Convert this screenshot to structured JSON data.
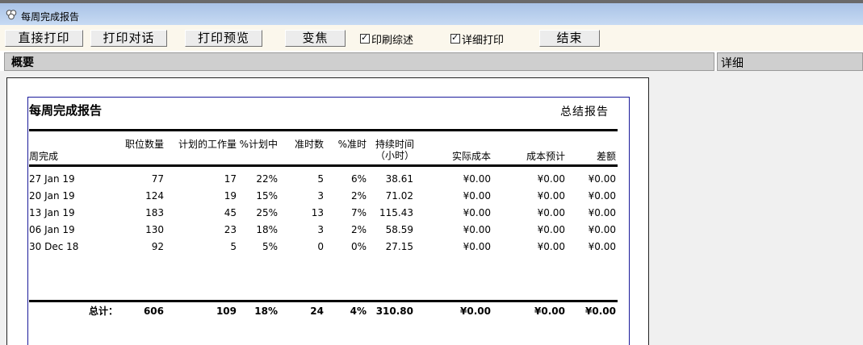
{
  "window": {
    "title": "每周完成报告"
  },
  "toolbar": {
    "direct_print": "直接打印",
    "print_dialog": "打印对话",
    "print_preview": "打印预览",
    "zoom": "变焦",
    "print_summary": "印刷综述",
    "print_detail": "详细打印",
    "finish": "结束"
  },
  "sections": {
    "overview": "概要",
    "detail": "详细"
  },
  "report": {
    "title": "每周完成报告",
    "right_title": "总结报告",
    "headers": {
      "week": "周完成",
      "positions": "职位数量",
      "planned_work": "计划的工作量",
      "pct_planned": "%计划中",
      "on_time_count": "准时数",
      "pct_on_time": "%准时",
      "duration": "持续时间",
      "duration_unit": "（小时）",
      "actual_cost": "实际成本",
      "cost_estimate": "成本预计",
      "variance": "差额"
    },
    "rows": [
      {
        "week": "27 Jan 19",
        "positions": "77",
        "planned": "17",
        "pct_planned": "22%",
        "on_time": "5",
        "pct_on_time": "6%",
        "duration": "38.61",
        "actual": "¥0.00",
        "estimate": "¥0.00",
        "variance": "¥0.00"
      },
      {
        "week": "20 Jan 19",
        "positions": "124",
        "planned": "19",
        "pct_planned": "15%",
        "on_time": "3",
        "pct_on_time": "2%",
        "duration": "71.02",
        "actual": "¥0.00",
        "estimate": "¥0.00",
        "variance": "¥0.00"
      },
      {
        "week": "13 Jan 19",
        "positions": "183",
        "planned": "45",
        "pct_planned": "25%",
        "on_time": "13",
        "pct_on_time": "7%",
        "duration": "115.43",
        "actual": "¥0.00",
        "estimate": "¥0.00",
        "variance": "¥0.00"
      },
      {
        "week": "06 Jan 19",
        "positions": "130",
        "planned": "23",
        "pct_planned": "18%",
        "on_time": "3",
        "pct_on_time": "2%",
        "duration": "58.59",
        "actual": "¥0.00",
        "estimate": "¥0.00",
        "variance": "¥0.00"
      },
      {
        "week": "30 Dec 18",
        "positions": "92",
        "planned": "5",
        "pct_planned": "5%",
        "on_time": "0",
        "pct_on_time": "0%",
        "duration": "27.15",
        "actual": "¥0.00",
        "estimate": "¥0.00",
        "variance": "¥0.00"
      }
    ],
    "totals": {
      "label": "总计：",
      "positions": "606",
      "planned": "109",
      "pct_planned": "18%",
      "on_time": "24",
      "pct_on_time": "4%",
      "duration": "310.80",
      "actual": "¥0.00",
      "estimate": "¥0.00",
      "variance": "¥0.00"
    }
  }
}
